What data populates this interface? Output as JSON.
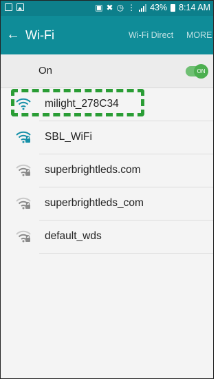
{
  "statusbar": {
    "icons": [
      "gallery-icon",
      "image-icon",
      "nfc-icon",
      "mute-icon",
      "alarm-icon",
      "wifi-icon",
      "signal-icon"
    ],
    "battery": "43%",
    "time": "8:14 AM"
  },
  "appbar": {
    "back_icon": "back-arrow-icon",
    "title": "Wi-Fi",
    "wifi_direct": "Wi-Fi Direct",
    "more": "MORE"
  },
  "wifi_toggle": {
    "label": "On",
    "state": "ON",
    "on": true
  },
  "networks": [
    {
      "name": "milight_278C34",
      "secured": false,
      "highlighted": true
    },
    {
      "name": "SBL_WiFi",
      "secured": true
    },
    {
      "name": "superbrightleds.com",
      "secured": true
    },
    {
      "name": "superbrightleds_com",
      "secured": true
    },
    {
      "name": "default_wds",
      "secured": true
    }
  ],
  "colors": {
    "statusbar": "#0d7f8b",
    "appbar": "#0f8c98",
    "highlight": "#2a9d35",
    "toggle": "#4caf50"
  }
}
